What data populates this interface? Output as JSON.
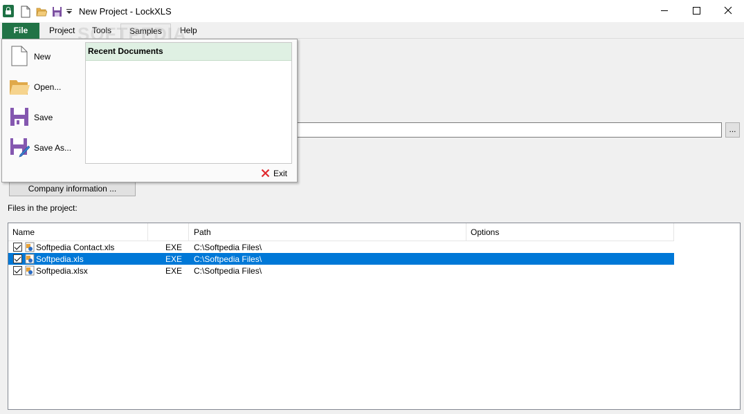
{
  "window": {
    "title": "New Project - LockXLS"
  },
  "menubar": {
    "file": "File",
    "project": "Project",
    "tools": "Tools",
    "samples": "Samples",
    "help": "Help"
  },
  "watermark": "SOFTPEDIA",
  "file_menu": {
    "new": "New",
    "open": "Open...",
    "save": "Save",
    "save_as": "Save As...",
    "recent_header": "Recent Documents",
    "exit": "Exit"
  },
  "form": {
    "browse_label": "...",
    "company_button": "Company information ...",
    "files_label": "Files in the project:"
  },
  "file_list": {
    "columns": [
      "Name",
      "",
      "Path",
      "Options"
    ],
    "rows": [
      {
        "name": "Softpedia Contact.xls",
        "type": "EXE",
        "path": "C:\\Softpedia Files\\",
        "checked": true,
        "selected": false
      },
      {
        "name": "Softpedia.xls",
        "type": "EXE",
        "path": "C:\\Softpedia Files\\",
        "checked": true,
        "selected": true
      },
      {
        "name": "Softpedia.xlsx",
        "type": "EXE",
        "path": "C:\\Softpedia Files\\",
        "checked": true,
        "selected": false
      }
    ]
  },
  "colors": {
    "file_tab": "#217346",
    "selection": "#0078d7",
    "recent_header_bg": "#dff0e3"
  }
}
